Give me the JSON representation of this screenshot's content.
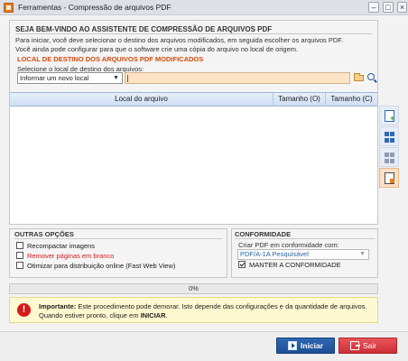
{
  "window": {
    "title": "Ferramentas - Compressão de arquivos PDF"
  },
  "welcome": {
    "title": "SEJA BEM-VINDO AO ASSISTENTE DE COMPRESSÃO DE ARQUIVOS PDF",
    "intro_line1": "Para iniciar, você deve selecionar o destino dos arquivos modificados, em seguida escolher os arquivos PDF.",
    "intro_line2": "Você ainda pode configurar para que o software crie uma cópia do arquivo no local de origem."
  },
  "destination": {
    "section_title": "LOCAL DE DESTINO DOS ARQUIVOS PDF MODIFICADOS",
    "label": "Selecione o local de destino dos arquivos:",
    "selected_option": "Informar um novo local",
    "path_value": ""
  },
  "table": {
    "columns": [
      "Local do arquivo",
      "Tamanho (O)",
      "Tamanho (C)"
    ],
    "rows": []
  },
  "sidebar_tools": [
    {
      "icon": "add-document-icon"
    },
    {
      "icon": "grid-view-icon"
    },
    {
      "icon": "grid-options-icon"
    },
    {
      "icon": "edit-document-icon"
    }
  ],
  "other_options": {
    "title": "OUTRAS OPÇÕES",
    "items": [
      {
        "label": "Recompactar imagens",
        "checked": false,
        "color": "#1a1a1a"
      },
      {
        "label": "Remover páginas em branco",
        "checked": false,
        "color": "#d21b1b"
      },
      {
        "label": "Otimizar para distribuição online (Fast Web View)",
        "checked": false,
        "color": "#1a1a1a"
      }
    ]
  },
  "conformity": {
    "title": "CONFORMIDADE",
    "label": "Criar PDF em conformidade com:",
    "selected_option": "PDF/A-1A Pesquisável",
    "keep_label": "MANTER A CONFORMIDADE",
    "keep_checked": true
  },
  "progress": {
    "value_percent": 0,
    "text": "0%"
  },
  "notice": {
    "bold": "Importante:",
    "text1": " Este procedimento pode demorar. Isto depende das configurações e da quantidade de arquivos. Quando estiver pronto, clique em ",
    "bold2": "INICIAR",
    "text2": "."
  },
  "buttons": {
    "start_label": "Iniciar",
    "exit_label": "Sair"
  },
  "colors": {
    "accent_orange": "#d24b0e",
    "start_blue": "#1e4f95",
    "exit_red": "#cc2f36",
    "notice_bg": "#fdf8cf"
  }
}
